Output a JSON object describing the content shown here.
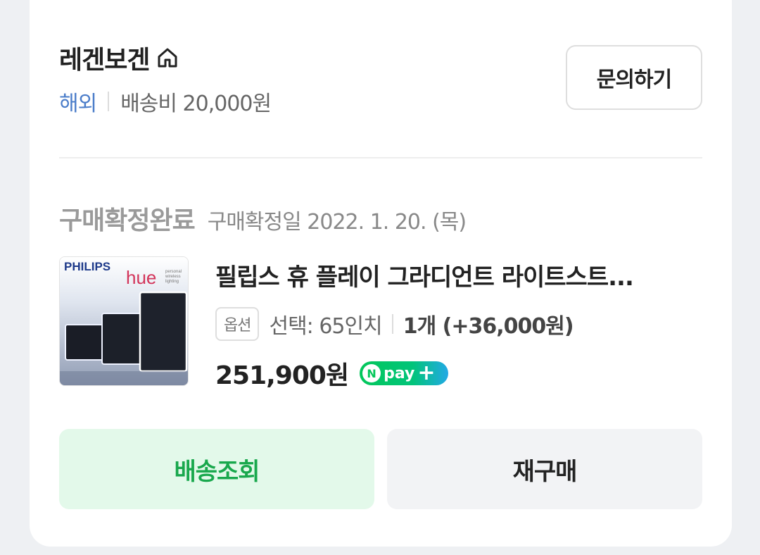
{
  "store": {
    "name": "레겐보겐",
    "icon": "home-icon",
    "region": "해외",
    "shipping": "배송비 20,000원",
    "inquiry_label": "문의하기"
  },
  "order": {
    "status": "구매확정완료",
    "confirm_date": "구매확정일 2022. 1. 20. (목)"
  },
  "product": {
    "thumbnail": {
      "brand": "PHILIPS",
      "sub_brand": "hue",
      "tagline": [
        "personal",
        "wireless",
        "lighting"
      ]
    },
    "name": "필립스 휴 플레이 그라디언트 라이트스트...",
    "option_tag": "옵션",
    "option_value": "선택: 65인치",
    "quantity": "1개 (+36,000원)",
    "price": "251,900원",
    "pay_badge": {
      "n": "N",
      "text": "pay",
      "plus": "+",
      "colors": [
        "#03c75a",
        "#22a9e6"
      ]
    }
  },
  "actions": {
    "track_label": "배송조회",
    "rebuy_label": "재구매"
  },
  "colors": {
    "accent_green": "#19a84d",
    "overseas_blue": "#4a7cc9"
  }
}
